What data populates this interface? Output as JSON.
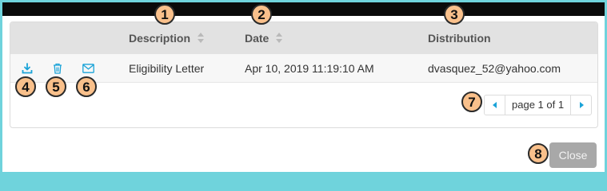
{
  "table": {
    "headers": {
      "description": "Description",
      "date": "Date",
      "distribution": "Distribution"
    },
    "rows": [
      {
        "description": "Eligibility Letter",
        "date": "Apr 10, 2019 11:19:10 AM",
        "distribution": "dvasquez_52@yahoo.com",
        "actions": [
          "download-icon",
          "trash-icon",
          "envelope-icon"
        ]
      }
    ]
  },
  "pagination": {
    "label": "page 1 of 1",
    "prev_icon": "chevron-left-icon",
    "next_icon": "chevron-right-icon"
  },
  "footer": {
    "close_label": "Close"
  },
  "callouts": {
    "description": "1",
    "date": "2",
    "distribution": "3",
    "download": "4",
    "delete": "5",
    "email": "6",
    "pagination": "7",
    "close": "8"
  },
  "colors": {
    "background_border": "#6fd3dc",
    "icon_accent": "#1aa3d8",
    "callout_fill": "#f9c08b",
    "close_button": "#a8a8a8",
    "header_bg": "#e2e2e2"
  }
}
